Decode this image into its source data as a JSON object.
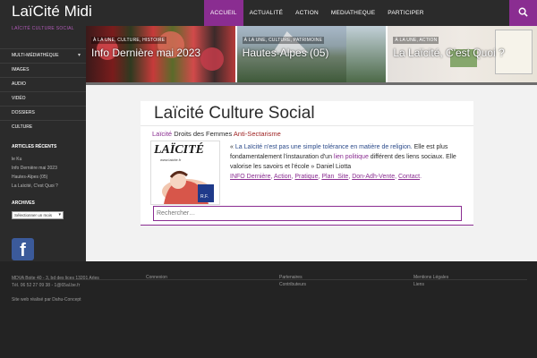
{
  "header": {
    "site_title": "LaïCité Midi",
    "nav": [
      "ACCUEIL",
      "ACTUALITÉ",
      "ACTION",
      "MEDIATHEQUE",
      "PARTICIPER"
    ],
    "active_index": 0,
    "accent": "#8a2d91"
  },
  "sidebar": {
    "tagline": "LAÏCITÉ CULTURE SOCIAL",
    "menu": [
      "MULTI-MÉDIATHÈQUE",
      "IMAGES",
      "AUDIO",
      "VIDÉO",
      "DOSSIERS",
      "CULTURE"
    ],
    "recent_title": "ARTICLES RÉCENTS",
    "recent_items": [
      "le Ku",
      "Info Dernière mai 2023",
      "Hautes-Alpes (05)",
      "La Laïcité, C'est Quoi ?"
    ],
    "archives_title": "ARCHIVES",
    "archives_select": "Sélectionner un mois",
    "facebook_icon": "facebook-icon"
  },
  "slider": [
    {
      "category": "À LA UNE, CULTURE, HISTOIRE",
      "title": "Info Dernière mai 2023"
    },
    {
      "category": "À LA UNE, CULTURE, PATRIMOINE",
      "title": "Hautes-Alpes (05)"
    },
    {
      "category": "À LA UNE, ACTION",
      "title": "La Laïcité, C'est Quoi ?"
    }
  ],
  "main": {
    "title": "Laïcité Culture Social",
    "subtitle_a": "Laïcité",
    "subtitle_b": " Droits des Femmes ",
    "subtitle_c": "Anti-Sectarisme",
    "quote_1": "« ",
    "quote_2": "La Laïcité n'est pas une simple tolérance en matière de religion.",
    "quote_3": " Elle est plus fondamentalement l'instauration d'un ",
    "quote_4": "lien politique",
    "quote_5": " différent des liens sociaux. Elle valorise les savoirs et l'école » Daniel Liotta",
    "links": [
      "INFO Dernière",
      "Action",
      "Pratique",
      "Plan_Site",
      "Don-Adh-Vente",
      "Contact"
    ],
    "search_placeholder": "Rechercher…",
    "logo_text": "LAÏCITÉ",
    "logo_url": "www.laicite.fr"
  },
  "footer": {
    "address": "MDVA Boite 40 - 3, bd des lices 13201 Arles",
    "phone": "Tél. 06 52 27 09 38 - 1@65al.be.fr",
    "credit": "Site web réalisé par Dahu-Concept",
    "col2": [
      "Connexion"
    ],
    "col3": [
      "Partenaires",
      "Contributeurs"
    ],
    "col4": [
      "Mentions Légales",
      "Liens"
    ]
  }
}
